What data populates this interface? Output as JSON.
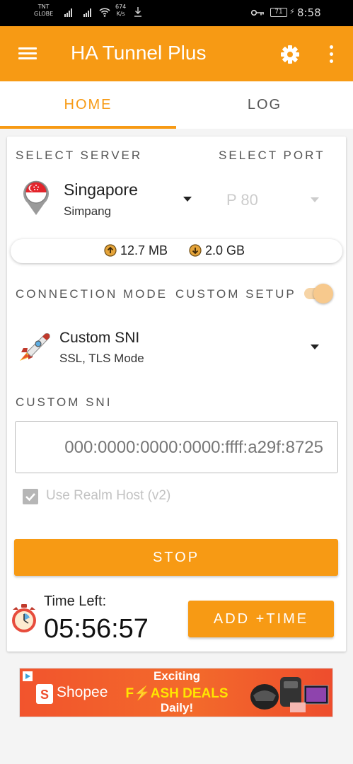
{
  "status_bar": {
    "carrier_line1": "TNT",
    "carrier_line2": "GLOBE",
    "speed_value": "674",
    "speed_unit": "K/s",
    "battery": "71",
    "time": "8:58"
  },
  "app_bar": {
    "title": "HA Tunnel Plus",
    "color": "#f79a14"
  },
  "tabs": [
    {
      "label": "HOME",
      "active": true
    },
    {
      "label": "LOG",
      "active": false
    }
  ],
  "server": {
    "select_server_label": "SELECT SERVER",
    "select_port_label": "SELECT PORT",
    "name": "Singapore",
    "location": "Simpang",
    "port": "P 80"
  },
  "data_usage": {
    "upload": "12.7 MB",
    "download": "2.0 GB"
  },
  "connection_mode": {
    "label": "CONNECTION MODE",
    "custom_setup_label": "CUSTOM SETUP",
    "custom_setup_enabled": true,
    "mode_name": "Custom SNI",
    "mode_sub": "SSL, TLS Mode"
  },
  "custom_sni": {
    "label": "CUSTOM SNI",
    "value": "000:0000:0000:0000:ffff:a29f:8725"
  },
  "realm_host": {
    "label": "Use Realm Host (v2)",
    "checked": true
  },
  "stop_button": "STOP",
  "timer": {
    "label": "Time Left:",
    "value": "05:56:57",
    "add_time_button": "ADD +TIME"
  },
  "ad": {
    "brand": "Shopee",
    "line1": "Exciting",
    "line2": "F⚡ASH DEALS",
    "line3": "Daily!"
  }
}
